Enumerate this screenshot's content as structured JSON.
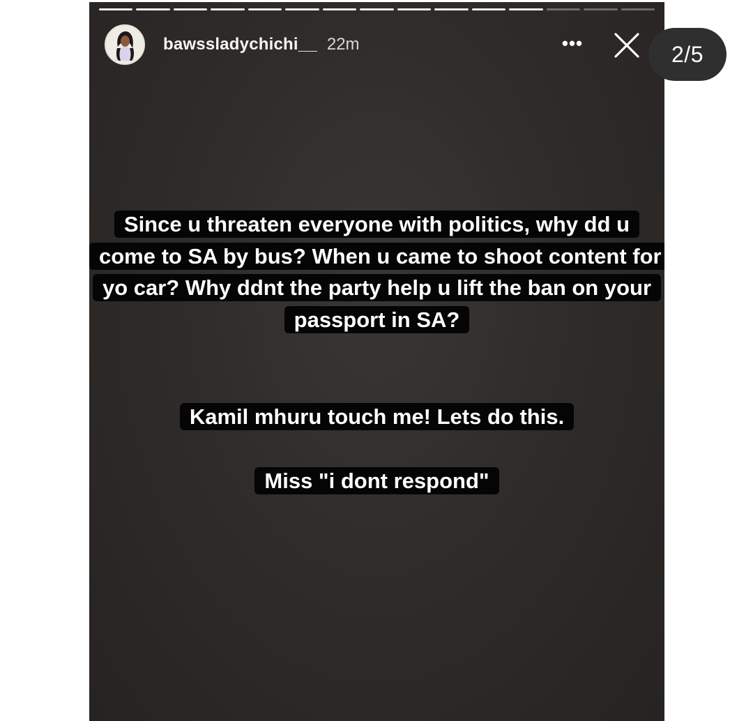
{
  "story": {
    "username": "bawssladychichi__",
    "time_ago": "22m",
    "more_glyph": "•••",
    "progress_total": 15,
    "progress_completed": 12
  },
  "counter": "2/5",
  "captions": [
    "Since u threaten everyone with politics, why dd u come to SA by bus? When u came to shoot content for yo car? Why ddnt the party help u lift the ban on your passport in SA?",
    "Kamil mhuru touch me! Lets do this.",
    "Miss \"i dont respond\""
  ],
  "colors": {
    "story_background": "#2f2c2a",
    "caption_background": "#050505",
    "caption_text": "#ffffff",
    "counter_background": "#2f2f2f"
  },
  "icons": {
    "close": "close-icon",
    "more": "more-options-icon",
    "avatar": "profile-avatar"
  }
}
